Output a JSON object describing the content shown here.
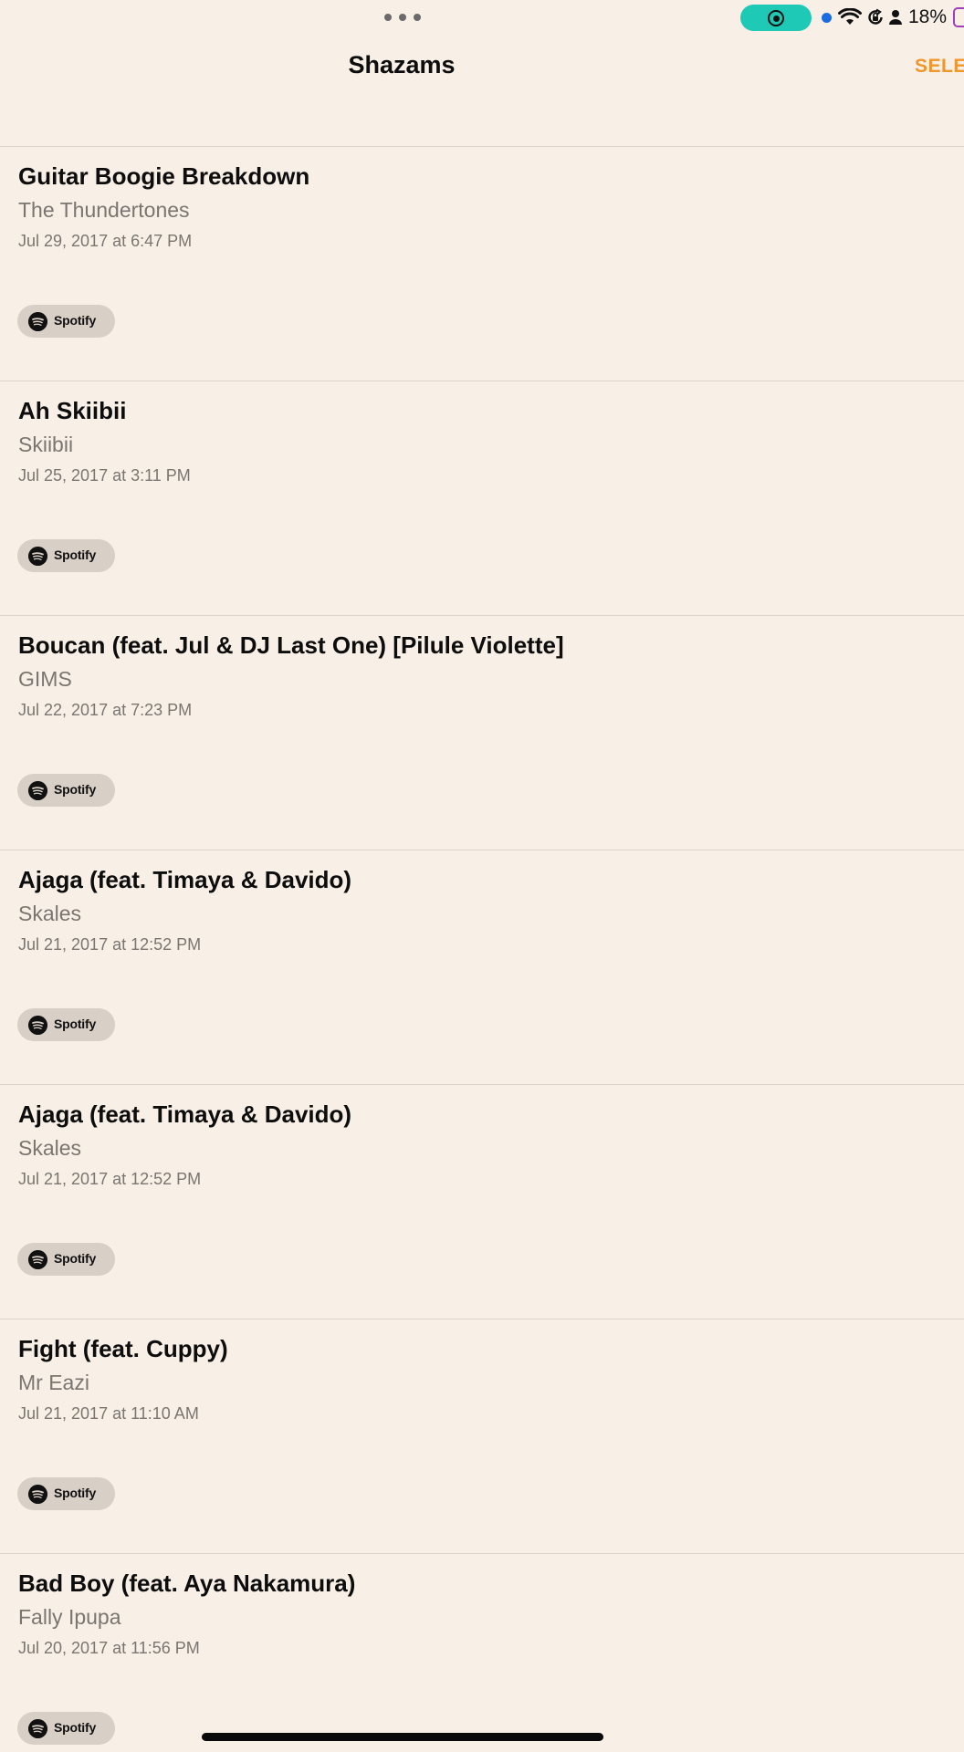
{
  "status_bar": {
    "battery_percent": "18%",
    "accent_colors": {
      "screen_record": "#1ec9b6",
      "mic_indicator": "#1a6de0",
      "battery": "#a040b8"
    }
  },
  "nav": {
    "title": "Shazams",
    "select_label": "SELE"
  },
  "badge_label": "Spotify",
  "tracks": [
    {
      "title": "Guitar Boogie Breakdown",
      "artist": "The Thundertones",
      "date": "Jul 29, 2017 at 6:47 PM"
    },
    {
      "title": "Ah Skiibii",
      "artist": "Skiibii",
      "date": "Jul 25, 2017 at 3:11 PM"
    },
    {
      "title": "Boucan (feat. Jul & DJ Last One) [Pilule Violette]",
      "artist": "GIMS",
      "date": "Jul 22, 2017 at 7:23 PM"
    },
    {
      "title": "Ajaga (feat. Timaya & Davido)",
      "artist": "Skales",
      "date": "Jul 21, 2017 at 12:52 PM"
    },
    {
      "title": "Ajaga (feat. Timaya & Davido)",
      "artist": "Skales",
      "date": "Jul 21, 2017 at 12:52 PM"
    },
    {
      "title": "Fight (feat. Cuppy)",
      "artist": "Mr Eazi",
      "date": "Jul 21, 2017 at 11:10 AM"
    },
    {
      "title": "Bad Boy (feat. Aya Nakamura)",
      "artist": "Fally Ipupa",
      "date": "Jul 20, 2017 at 11:56 PM"
    }
  ],
  "colors": {
    "background": "#f8efe7",
    "accent": "#f0962b"
  }
}
